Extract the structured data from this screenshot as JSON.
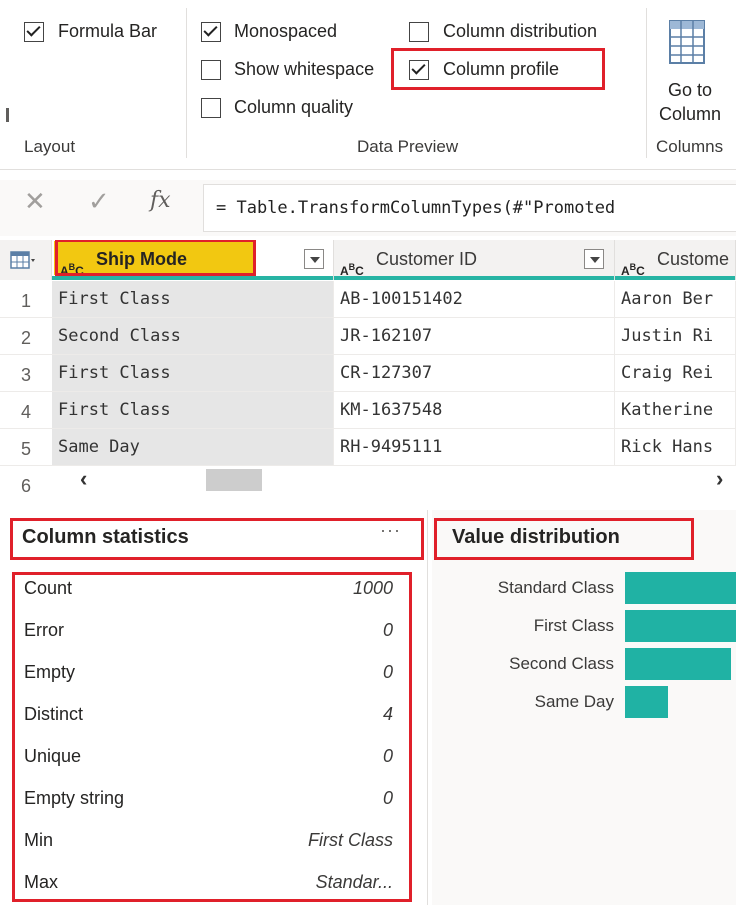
{
  "ribbon": {
    "layout": {
      "label": "Layout",
      "formula_bar": {
        "label": "Formula Bar",
        "checked": true
      }
    },
    "data_preview": {
      "label": "Data Preview",
      "monospaced": {
        "label": "Monospaced",
        "checked": true
      },
      "show_whitespace": {
        "label": "Show whitespace",
        "checked": false
      },
      "column_quality": {
        "label": "Column quality",
        "checked": false
      },
      "column_distribution": {
        "label": "Column distribution",
        "checked": false
      },
      "column_profile": {
        "label": "Column profile",
        "checked": true
      }
    },
    "columns": {
      "label": "Columns",
      "go_to_column_line1": "Go to",
      "go_to_column_line2": "Column",
      "icon": "table-grid-icon"
    }
  },
  "formula_bar": {
    "cancel_icon": "close-icon",
    "confirm_icon": "check-icon",
    "fx_label": "fx",
    "formula": "= Table.TransformColumnTypes(#\"Promoted"
  },
  "grid": {
    "columns": [
      {
        "type_label": "ABC",
        "name": "Ship Mode",
        "selected": true
      },
      {
        "type_label": "ABC",
        "name": "Customer ID",
        "selected": false
      },
      {
        "type_label": "ABC",
        "name": "Custome",
        "selected": false
      }
    ],
    "rows": [
      {
        "num": "1",
        "cells": [
          "First Class",
          "AB-100151402",
          "Aaron Ber"
        ]
      },
      {
        "num": "2",
        "cells": [
          "Second Class",
          "JR-162107",
          "Justin Ri"
        ]
      },
      {
        "num": "3",
        "cells": [
          "First Class",
          "CR-127307",
          "Craig Rei"
        ]
      },
      {
        "num": "4",
        "cells": [
          "First Class",
          "KM-1637548",
          "Katherine"
        ]
      },
      {
        "num": "5",
        "cells": [
          "Same Day",
          "RH-9495111",
          "Rick Hans"
        ]
      }
    ],
    "last_row_num": "6"
  },
  "column_statistics": {
    "title": "Column statistics",
    "more_label": "···",
    "items": [
      {
        "label": "Count",
        "value": "1000"
      },
      {
        "label": "Error",
        "value": "0"
      },
      {
        "label": "Empty",
        "value": "0"
      },
      {
        "label": "Distinct",
        "value": "4"
      },
      {
        "label": "Unique",
        "value": "0"
      },
      {
        "label": "Empty string",
        "value": "0"
      },
      {
        "label": "Min",
        "value": "First Class"
      },
      {
        "label": "Max",
        "value": "Standar..."
      }
    ]
  },
  "value_distribution": {
    "title": "Value distribution",
    "bar_color": "#20b2a4",
    "items": [
      {
        "label": "Standard Class",
        "share": 1.0
      },
      {
        "label": "First Class",
        "share": 1.0
      },
      {
        "label": "Second Class",
        "share": 0.95
      },
      {
        "label": "Same Day",
        "share": 0.38
      }
    ]
  },
  "colors": {
    "accent": "#27b4a4",
    "selected_header": "#f2c811",
    "highlight_border": "#e0202a"
  }
}
